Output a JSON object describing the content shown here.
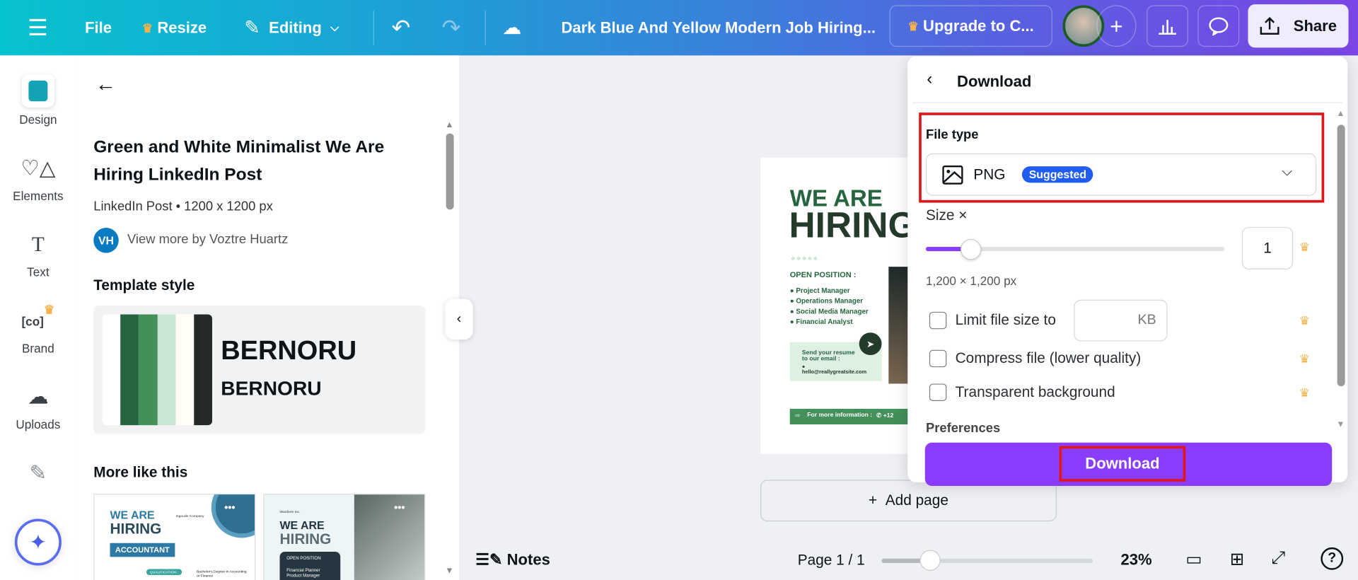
{
  "topbar": {
    "file": "File",
    "resize": "Resize",
    "editing": "Editing",
    "doc_title": "Dark Blue And Yellow Modern Job Hiring...",
    "upgrade": "Upgrade to C...",
    "share": "Share"
  },
  "rail": [
    {
      "label": "Design"
    },
    {
      "label": "Elements"
    },
    {
      "label": "Text"
    },
    {
      "label": "Brand"
    },
    {
      "label": "Uploads"
    }
  ],
  "panel": {
    "title": "Green and White Minimalist We Are Hiring LinkedIn Post",
    "meta": "LinkedIn Post • 1200 x 1200 px",
    "author_initials": "VH",
    "author_link": "View more by Voztre Huartz",
    "template_style": "Template style",
    "font_sample_1": "BERNORU",
    "font_sample_2": "BERNORU",
    "palette": [
      "#ffffff",
      "#276540",
      "#43905a",
      "#cbe6d2",
      "#fffdf5",
      "#242b27"
    ],
    "more_like_this": "More like this",
    "thumbs": [
      {
        "t1": "WE ARE",
        "t2": "HIRING",
        "tag": "ACCOUNTANT",
        "company": "Ingoude Company",
        "extra": "QUALIFICATION :",
        "extra2": "Bachelor's Degree in Accounting or Finance"
      },
      {
        "t1": "WE ARE",
        "t2": "HIRING",
        "tag": "OPEN POSITION",
        "company": "Wardiere Inc.",
        "extra": "Financial Planner",
        "extra2": "Product Manager"
      }
    ]
  },
  "poster": {
    "line1": "WE ARE",
    "line2": "HIRING",
    "open": "OPEN POSITION :",
    "positions": [
      "Project Manager",
      "Operations Manager",
      "Social Media Manager",
      "Financial Analyst"
    ],
    "send1": "Send your resume",
    "send2": "to our email :",
    "email": "hello@reallygreatsite.com",
    "footer": "For more information :",
    "phone": "+12"
  },
  "add_page": "Add page",
  "download": {
    "title": "Download",
    "file_type_label": "File type",
    "file_type": "PNG",
    "suggested": "Suggested",
    "size_label": "Size ×",
    "size_value": "1",
    "size_fraction": 0.15,
    "dimensions": "1,200 × 1,200 px",
    "limit_label": "Limit file size to",
    "kb": "KB",
    "compress_label": "Compress file (lower quality)",
    "transparent_label": "Transparent background",
    "preferences": "Preferences",
    "button": "Download"
  },
  "bottom": {
    "notes": "Notes",
    "page": "Page 1 / 1",
    "zoom": "23%",
    "zoom_fraction": 0.23
  },
  "colors": {
    "accent": "#8b3dff",
    "highlight": "#e0161b",
    "suggested": "#1f5cf0"
  }
}
